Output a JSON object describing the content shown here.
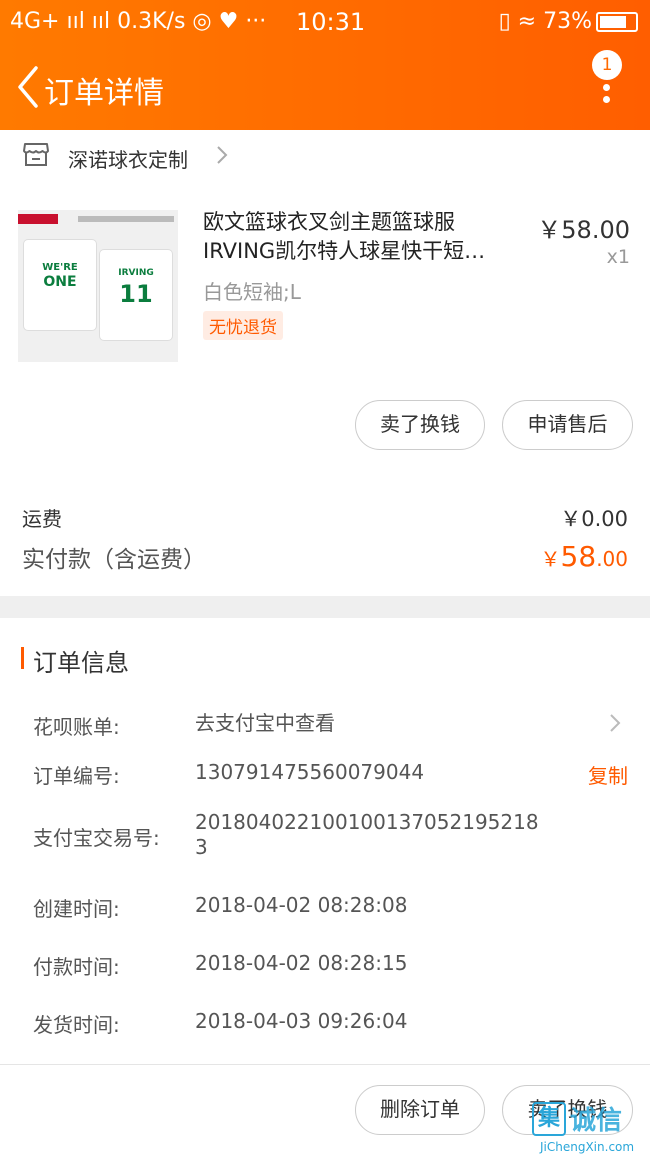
{
  "status_bar": {
    "left": "4G+ ııl  ııl 0.3K/s ◎ ♥ ···",
    "time": "10:31",
    "right": "▯ ≈ 73%"
  },
  "header": {
    "title": "订单详情",
    "notification_count": "1"
  },
  "shop": {
    "name": "深诺球衣定制"
  },
  "item": {
    "title": "欧文篮球衣叉剑主题篮球服IRVING凯尔特人球星快干短…",
    "price": "￥58.00",
    "quantity": "x1",
    "sku": "白色短袖;L",
    "badge": "无忧退货",
    "thumb": {
      "shirt1_line1": "WE'RE",
      "shirt1_line2": "ONE",
      "shirt2_name": "IRVING",
      "shirt2_number": "11"
    }
  },
  "item_actions": {
    "sell": "卖了换钱",
    "after_sales": "申请售后"
  },
  "summary": {
    "shipping_label": "运费",
    "shipping_value": "￥0.00",
    "paid_label": "实付款（含运费）",
    "paid_currency": "￥",
    "paid_integer": "58",
    "paid_decimal": ".00"
  },
  "order_info": {
    "title": "订单信息",
    "rows": [
      {
        "label": "花呗账单:",
        "value": "去支付宝中查看"
      },
      {
        "label": "订单编号:",
        "value": "130791475560079044"
      },
      {
        "label": "支付宝交易号:",
        "value": "201804022100100137052195218\n3"
      },
      {
        "label": "创建时间:",
        "value": "2018-04-02 08:28:08"
      },
      {
        "label": "付款时间:",
        "value": "2018-04-02 08:28:15"
      },
      {
        "label": "发货时间:",
        "value": "2018-04-03 09:26:04"
      }
    ],
    "copy": "复制"
  },
  "footer": {
    "delete": "删除订单",
    "sell": "卖了换钱"
  },
  "watermark": {
    "glyph": "集",
    "text": "诚信",
    "url": "JiChengXin.com"
  },
  "colors": {
    "brand": "#ff6a00",
    "accent": "#ff5a00"
  }
}
